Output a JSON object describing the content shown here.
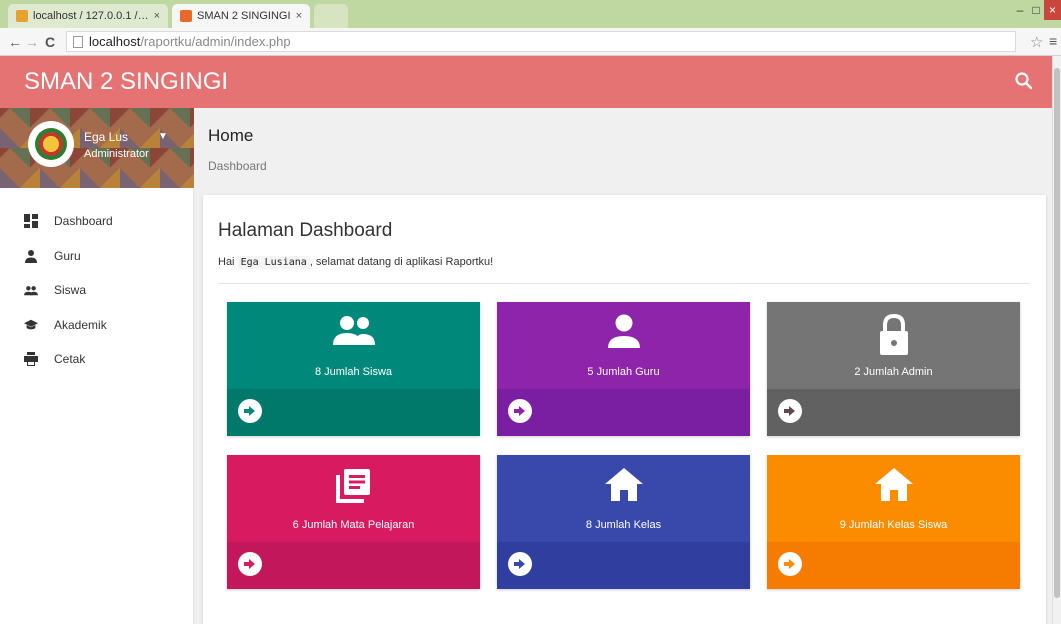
{
  "browser": {
    "tabs": [
      {
        "title": "localhost / 127.0.0.1 / rapo"
      },
      {
        "title": "SMAN 2 SINGINGI"
      }
    ],
    "url_host": "localhost",
    "url_path": "/raportku/admin/index.php"
  },
  "header": {
    "title": "SMAN 2 SINGINGI"
  },
  "profile": {
    "name": "Ega Lus",
    "role": "Administrator"
  },
  "sidebar": {
    "items": [
      {
        "label": "Dashboard",
        "icon": "dashboard-icon"
      },
      {
        "label": "Guru",
        "icon": "person-icon"
      },
      {
        "label": "Siswa",
        "icon": "people-icon"
      },
      {
        "label": "Akademik",
        "icon": "school-icon"
      },
      {
        "label": "Cetak",
        "icon": "print-icon"
      }
    ]
  },
  "page": {
    "title": "Home",
    "breadcrumb": "Dashboard"
  },
  "card": {
    "title": "Halaman Dashboard",
    "greeting_prefix": "Hai ",
    "greeting_name": "Ega Lusiana",
    "greeting_suffix": ", selamat datang di aplikasi Raportku!"
  },
  "stats": [
    {
      "label": "8 Jumlah Siswa",
      "icon": "people-icon",
      "color": "#00897b"
    },
    {
      "label": "5 Jumlah Guru",
      "icon": "person-icon",
      "color": "#8e24aa"
    },
    {
      "label": "2 Jumlah Admin",
      "icon": "lock-icon",
      "color": "#757575"
    },
    {
      "label": "6 Jumlah Mata Pelajaran",
      "icon": "library-books-icon",
      "color": "#d81b60"
    },
    {
      "label": "8 Jumlah Kelas",
      "icon": "home-icon",
      "color": "#3949ab"
    },
    {
      "label": "9 Jumlah Kelas Siswa",
      "icon": "home-icon",
      "color": "#fb8c00"
    }
  ],
  "colors": {
    "header": "#e57373"
  }
}
